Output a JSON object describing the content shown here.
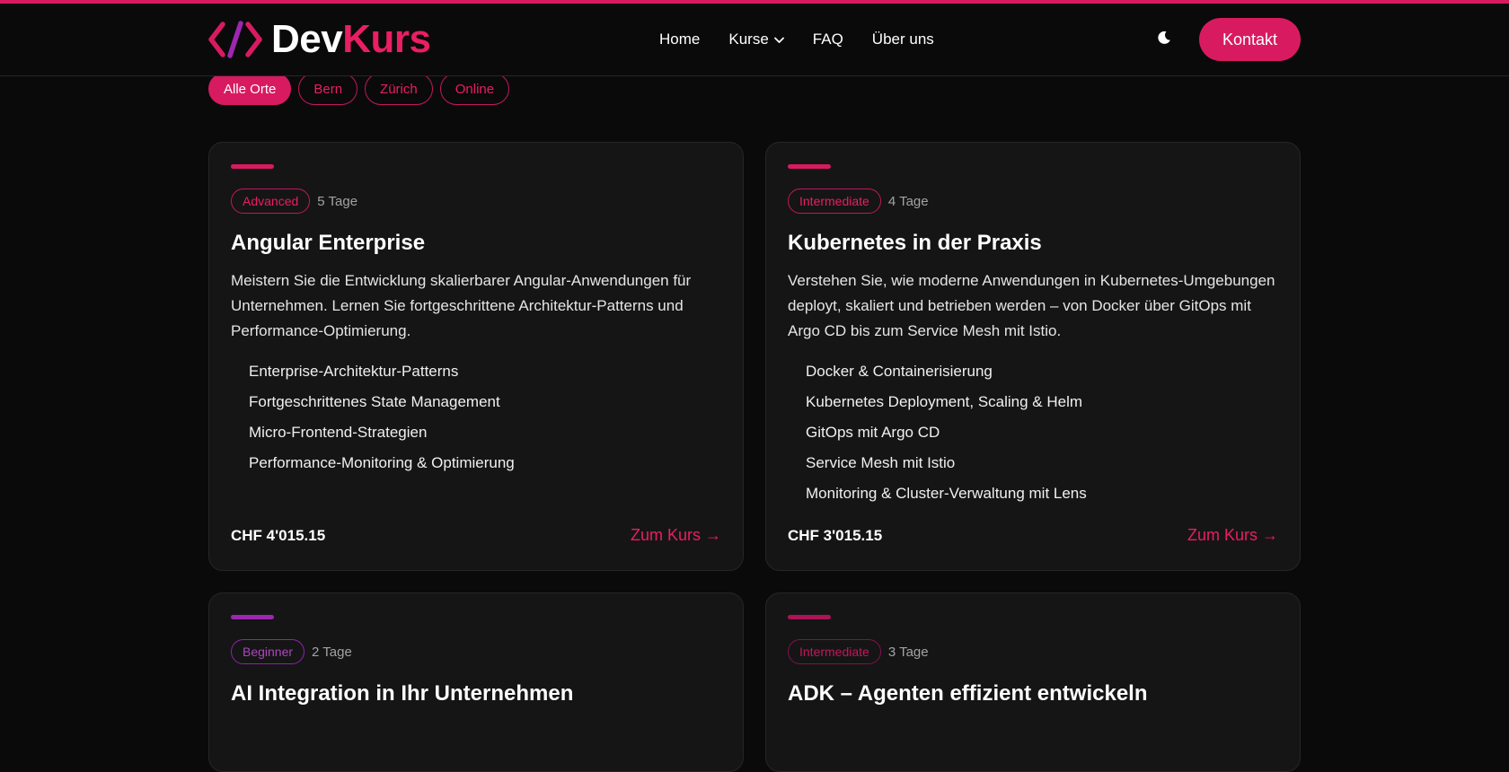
{
  "colors": {
    "accent": "#d81b60",
    "accent_light": "#e91e63",
    "purple": "#9c27b0",
    "magenta_dark": "#ad1457",
    "background": "#0a0a0a",
    "card": "#151515"
  },
  "logo": {
    "part1": "Dev",
    "part2": "Kurs",
    "icon": "code-brackets-icon"
  },
  "nav": {
    "home": "Home",
    "courses": "Kurse",
    "faq": "FAQ",
    "about": "Über uns"
  },
  "header": {
    "theme_icon": "moon-icon",
    "contact": "Kontakt"
  },
  "filters": [
    "Alle Orte",
    "Bern",
    "Zürich",
    "Online"
  ],
  "courses": [
    {
      "level": "Advanced",
      "duration": "5 Tage",
      "title": "Angular Enterprise",
      "description": "Meistern Sie die Entwicklung skalierbarer Angular-Anwendungen für Unternehmen. Lernen Sie fortgeschrittene Architektur-Patterns und Performance-Optimierung.",
      "features": [
        "Enterprise-Architektur-Patterns",
        "Fortgeschrittenes State Management",
        "Micro-Frontend-Strategien",
        "Performance-Monitoring & Optimierung"
      ],
      "price": "CHF 4'015.15",
      "cta": "Zum Kurs →"
    },
    {
      "level": "Intermediate",
      "duration": "4 Tage",
      "title": "Kubernetes in der Praxis",
      "description": "Verstehen Sie, wie moderne Anwendungen in Kubernetes-Umgebungen deployt, skaliert und betrieben werden – von Docker über GitOps mit Argo CD bis zum Service Mesh mit Istio.",
      "features": [
        "Docker & Containerisierung",
        "Kubernetes Deployment, Scaling & Helm",
        "GitOps mit Argo CD",
        "Service Mesh mit Istio",
        "Monitoring & Cluster-Verwaltung mit Lens"
      ],
      "price": "CHF 3'015.15",
      "cta": "Zum Kurs →"
    },
    {
      "level": "Beginner",
      "duration": "2 Tage",
      "title": "AI Integration in Ihr Unternehmen"
    },
    {
      "level": "Intermediate",
      "duration": "3 Tage",
      "title": "ADK – Agenten effizient entwickeln"
    }
  ]
}
